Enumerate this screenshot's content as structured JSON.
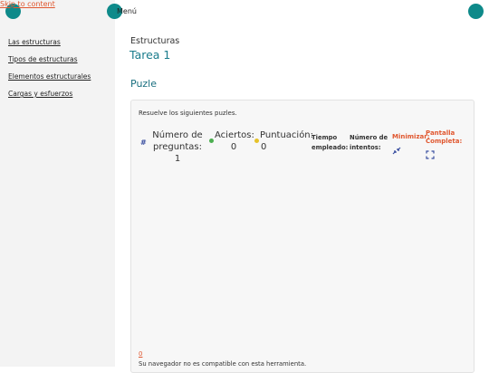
{
  "skip_link": "Skip to content",
  "menu_label": "Menú",
  "sidebar": {
    "items": [
      {
        "label": "Las estructuras"
      },
      {
        "label": "Tipos de estructuras"
      },
      {
        "label": "Elementos estructurales"
      },
      {
        "label": "Cargas y esfuerzos"
      }
    ]
  },
  "breadcrumb": "Estructuras",
  "page_title": "Tarea 1",
  "section_title": "Puzle",
  "puzzle": {
    "instructions": "Resuelve los siguientes puzles.",
    "hash": "#",
    "questions_label": "Número de preguntas: 1",
    "hits_label": "Aciertos:",
    "hits_value": "0",
    "score_label": "Puntuación:",
    "score_value": "0",
    "time_label": "Tiempo empleado:",
    "attempts_label": "Número de intentos:",
    "minimize_label": "Minimizar:",
    "fullscreen_label": "Pantalla Completa:",
    "zero_link": "0",
    "incompatible": "Su navegador no es compatible con esta herramienta."
  },
  "colors": {
    "accent": "#0e8a8a",
    "title": "#1a7c8c",
    "link_orange": "#e0572f",
    "icon_blue": "#3a4fa0",
    "hits_dot": "#4caf50",
    "score_dot": "#e6c229"
  },
  "icons": {
    "minimize": "minimize-arrows-icon",
    "fullscreen": "fullscreen-corners-icon"
  }
}
